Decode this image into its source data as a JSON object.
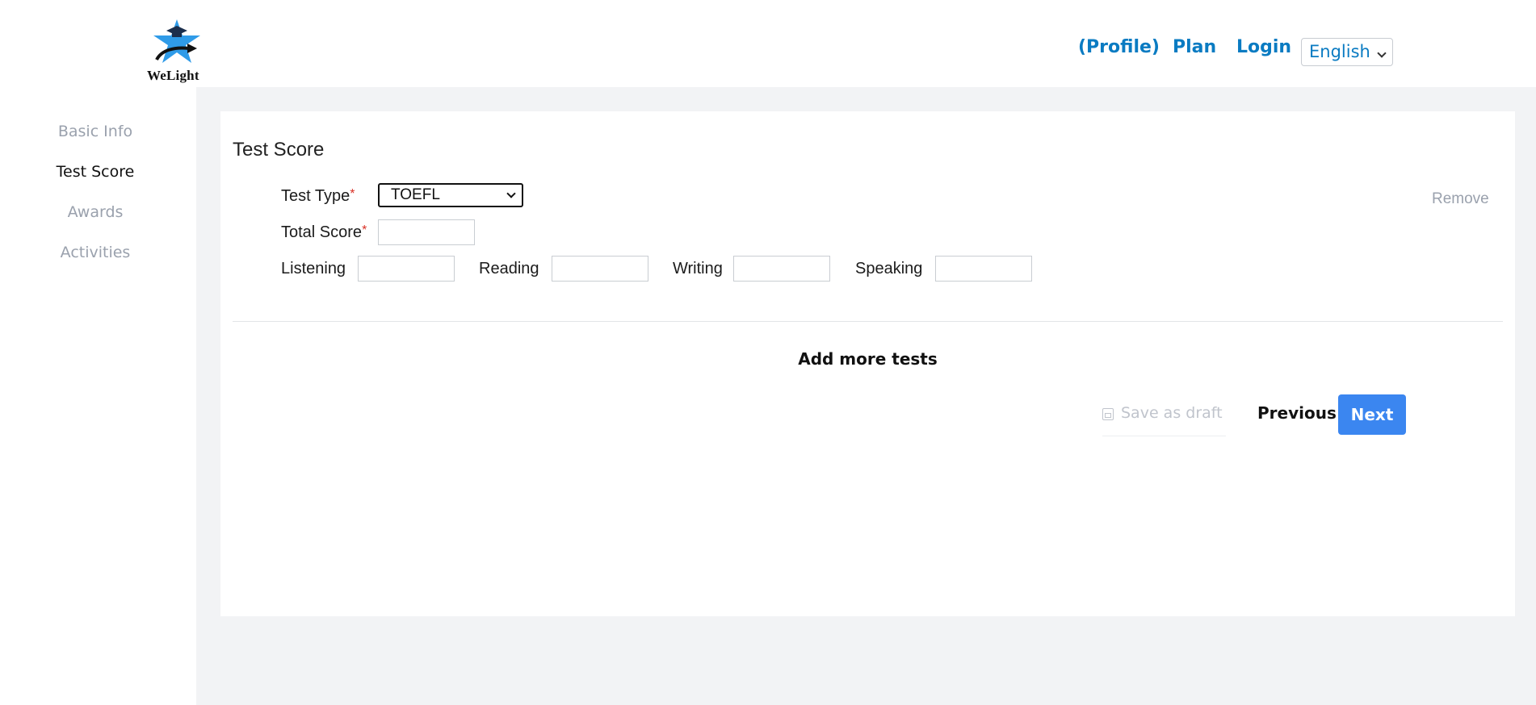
{
  "brand": {
    "name": "WeLight"
  },
  "topnav": {
    "profile": "(Profile)",
    "plan": "Plan",
    "login": "Login",
    "language": "English"
  },
  "sidebar": {
    "items": [
      {
        "label": "Basic Info",
        "active": false
      },
      {
        "label": "Test Score",
        "active": true
      },
      {
        "label": "Awards",
        "active": false
      },
      {
        "label": "Activities",
        "active": false
      }
    ]
  },
  "form": {
    "title": "Test Score",
    "test_type_label": "Test Type",
    "required_mark": "*",
    "test_type_value": "TOEFL",
    "total_score_label": "Total Score",
    "total_score_value": "",
    "sub_scores": [
      {
        "label": "Listening",
        "value": ""
      },
      {
        "label": "Reading",
        "value": ""
      },
      {
        "label": "Writing",
        "value": ""
      },
      {
        "label": "Speaking",
        "value": ""
      }
    ],
    "remove_label": "Remove",
    "add_more_label": "Add more tests"
  },
  "actions": {
    "save_draft": "Save as draft",
    "previous": "Previous",
    "next": "Next"
  },
  "colors": {
    "link_blue": "#0a7bc2",
    "primary_button": "#3b86f0",
    "content_bg": "#f2f3f5"
  }
}
